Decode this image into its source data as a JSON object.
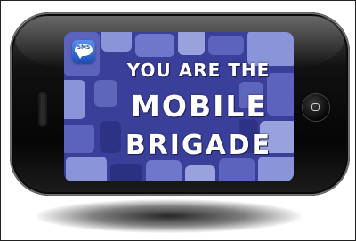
{
  "app_icon": {
    "label": "SMS",
    "icon": "sms-bubble-icon"
  },
  "screen": {
    "headline_line1": "YOU ARE THE",
    "headline_line2": "MOBILE",
    "headline_line3": "BRIGADE"
  },
  "colors": {
    "screen_background": "#3a3f9a",
    "tile_light": "#8a94d8",
    "tile_dark": "#2c3080",
    "phone_body": "#111111",
    "headline_text": "#ffffff"
  }
}
